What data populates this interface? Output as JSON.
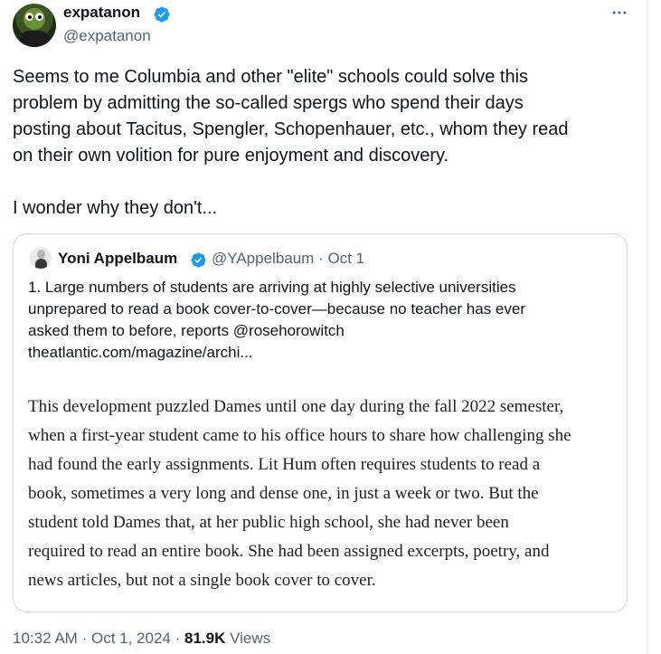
{
  "author": {
    "display_name": "expatanon",
    "handle": "@expatanon",
    "verified": true
  },
  "more_icon": "more-horizontal-icon",
  "tweet": {
    "text": "Seems to me Columbia and other \"elite\" schools could solve this\nproblem by admitting the so-called spergs who spend their days\nposting about Tacitus, Spengler, Schopenhauer, etc., whom they read\non their own volition for pure enjoyment and discovery.\n\nI wonder why they don't..."
  },
  "quote": {
    "display_name": "Yoni Appelbaum",
    "handle": "@YAppelbaum",
    "separator": "·",
    "date": "Oct 1",
    "verified": true,
    "text": "1. Large numbers of students are arriving at highly selective universities\nunprepared to read a book cover-to-cover—because no teacher has ever\nasked them to before, reports @rosehorowitch\ntheatlantic.com/magazine/archi...",
    "excerpt_lines": [
      "This development puzzled Dames until one day during the fall 2022 semester,",
      "when a first-year student came to his office hours to share how challenging she",
      "had found the early assignments. Lit Hum often requires students to read a",
      "book, sometimes a very long and dense one, in just a week or two. But the",
      "student told Dames that, at her public high school, she had never been",
      "required to read an entire book. She had been assigned excerpts, poetry, and",
      "news articles, but not a single book cover to cover."
    ]
  },
  "footer": {
    "time": "10:32 AM",
    "separator": "·",
    "date": "Oct 1, 2024",
    "views_count": "81.9K",
    "views_label": "Views"
  },
  "colors": {
    "verified_blue": "#1d9bf0",
    "secondary_text": "#536471",
    "border": "#cfd9de"
  }
}
